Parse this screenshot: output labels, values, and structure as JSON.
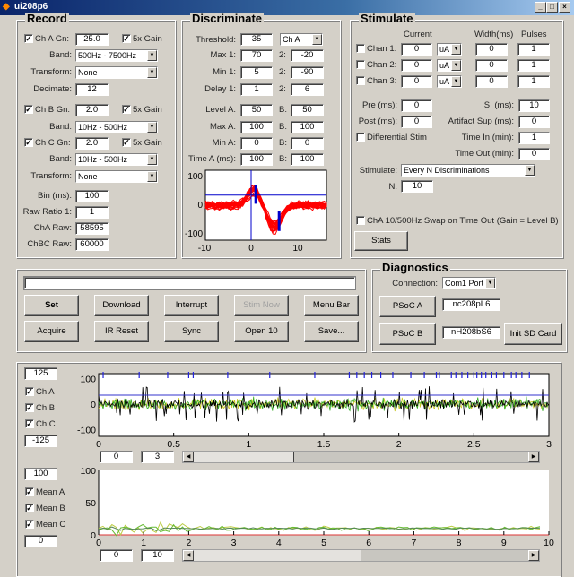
{
  "window": {
    "title": "ui208p6",
    "controls": [
      "minimize",
      "maximize",
      "close"
    ]
  },
  "record": {
    "title": "Record",
    "ch_a": {
      "label": "Ch A Gn:",
      "checked": true,
      "gain": "25.0",
      "x5_label": "5x Gain",
      "x5_checked": true
    },
    "band_label": "Band:",
    "band_a": "500Hz - 7500Hz",
    "transform_label": "Transform:",
    "transform_a": "None",
    "decimate_label": "Decimate:",
    "decimate": "12",
    "ch_b": {
      "label": "Ch B Gn:",
      "checked": true,
      "gain": "2.0",
      "x5_label": "5x Gain",
      "x5_checked": true
    },
    "band_b": "10Hz - 500Hz",
    "ch_c": {
      "label": "Ch C Gn:",
      "checked": true,
      "gain": "2.0",
      "x5_label": "5x Gain",
      "x5_checked": true
    },
    "band_c": "10Hz - 500Hz",
    "transform_c": "None",
    "bin_label": "Bin (ms):",
    "bin": "100",
    "raw_ratio_label": "Raw Ratio 1:",
    "raw_ratio": "1",
    "cha_raw_label": "ChA Raw:",
    "cha_raw": "58595",
    "chbc_raw_label": "ChBC Raw:",
    "chbc_raw": "60000"
  },
  "discriminate": {
    "title": "Discriminate",
    "threshold_label": "Threshold:",
    "threshold": "35",
    "channel": "Ch A",
    "rows": [
      {
        "label": "Max 1:",
        "a": "70",
        "sep": "2:",
        "b": "-20"
      },
      {
        "label": "Min 1:",
        "a": "5",
        "sep": "2:",
        "b": "-90"
      },
      {
        "label": "Delay 1:",
        "a": "1",
        "sep": "2:",
        "b": "6"
      },
      {
        "label": "Level A:",
        "a": "50",
        "sep": "B:",
        "b": "50"
      },
      {
        "label": "Max A:",
        "a": "100",
        "sep": "B:",
        "b": "100"
      },
      {
        "label": "Min A:",
        "a": "0",
        "sep": "B:",
        "b": "0"
      },
      {
        "label": "Time A (ms):",
        "a": "100",
        "sep": "B:",
        "b": "100"
      }
    ],
    "plot": {
      "yticks": [
        "100",
        "0",
        "-100"
      ],
      "xticks": [
        "-10",
        "0",
        "10"
      ],
      "trace_color": "#ff0000",
      "marker_color": "#0000cc"
    }
  },
  "stimulate": {
    "title": "Stimulate",
    "headers": {
      "current": "Current",
      "width": "Width(ms)",
      "pulses": "Pulses"
    },
    "chans": [
      {
        "label": "Chan 1:",
        "checked": false,
        "current": "0",
        "unit": "uA",
        "width": "0",
        "pulses": "1"
      },
      {
        "label": "Chan 2:",
        "checked": false,
        "current": "0",
        "unit": "uA",
        "width": "0",
        "pulses": "1"
      },
      {
        "label": "Chan 3:",
        "checked": false,
        "current": "0",
        "unit": "uA",
        "width": "0",
        "pulses": "1"
      }
    ],
    "pre_label": "Pre (ms):",
    "pre": "0",
    "post_label": "Post (ms):",
    "post": "0",
    "isi_label": "ISI (ms):",
    "isi": "10",
    "artifact_label": "Artifact Sup (ms):",
    "artifact": "0",
    "diff_label": "Differential Stim",
    "diff_checked": false,
    "time_in_label": "Time In (min):",
    "time_in": "1",
    "time_out_label": "Time Out (min):",
    "time_out": "0",
    "mode_label": "Stimulate:",
    "mode": "Every N Discriminations",
    "n_label": "N:",
    "n": "10",
    "swap_label": "ChA 10/500Hz Swap on Time Out (Gain = Level B)",
    "swap_checked": false,
    "stats": "Stats"
  },
  "controls": {
    "status": "",
    "buttons": [
      {
        "label": "Set",
        "bold": true,
        "disabled": false
      },
      {
        "label": "Download",
        "disabled": false
      },
      {
        "label": "Interrupt",
        "disabled": false
      },
      {
        "label": "Stim Now",
        "disabled": true
      },
      {
        "label": "Menu Bar",
        "disabled": false
      },
      {
        "label": "Acquire",
        "disabled": false
      },
      {
        "label": "IR Reset",
        "disabled": false
      },
      {
        "label": "Sync",
        "disabled": false
      },
      {
        "label": "Open 10",
        "disabled": false
      },
      {
        "label": "Save...",
        "disabled": false
      }
    ]
  },
  "diagnostics": {
    "title": "Diagnostics",
    "connection_label": "Connection:",
    "connection": "Com1 Port",
    "psoc_a": "PSoC A",
    "psoc_a_value": "nc208pL6",
    "psoc_b": "PSoC B",
    "psoc_b_value": "nH208bS6",
    "init_sd": "Init SD Card"
  },
  "raw_plot": {
    "ymax": "125",
    "ymin": "-125",
    "channels": [
      {
        "label": "Ch A",
        "checked": true
      },
      {
        "label": "Ch B",
        "checked": true
      },
      {
        "label": "Ch C",
        "checked": true
      }
    ],
    "yticks": [
      "100",
      "0",
      "-100"
    ],
    "xticks": [
      "0",
      "0.5",
      "1",
      "1.5",
      "2",
      "2.5",
      "3"
    ],
    "from": "0",
    "to": "3",
    "scroll_position": 0,
    "colors": {
      "ch_a": "#000000",
      "ch_b": "#33aa22",
      "ch_c": "#c8c820",
      "threshold": "#3333cc",
      "events": "#2222dd"
    }
  },
  "mean_plot": {
    "ymax": "100",
    "ymin": "0",
    "channels": [
      {
        "label": "Mean A",
        "checked": true
      },
      {
        "label": "Mean B",
        "checked": true
      },
      {
        "label": "Mean C",
        "checked": true
      }
    ],
    "yticks": [
      "100",
      "50",
      "0"
    ],
    "xticks": [
      "0",
      "1",
      "2",
      "3",
      "4",
      "5",
      "6",
      "7",
      "8",
      "9",
      "10"
    ],
    "from": "0",
    "to": "10",
    "scroll_position": 0,
    "colors": {
      "mean_a": "#558855",
      "mean_b": "#66bb33",
      "mean_c": "#bbcc44",
      "baseline": "#dd3333"
    }
  }
}
